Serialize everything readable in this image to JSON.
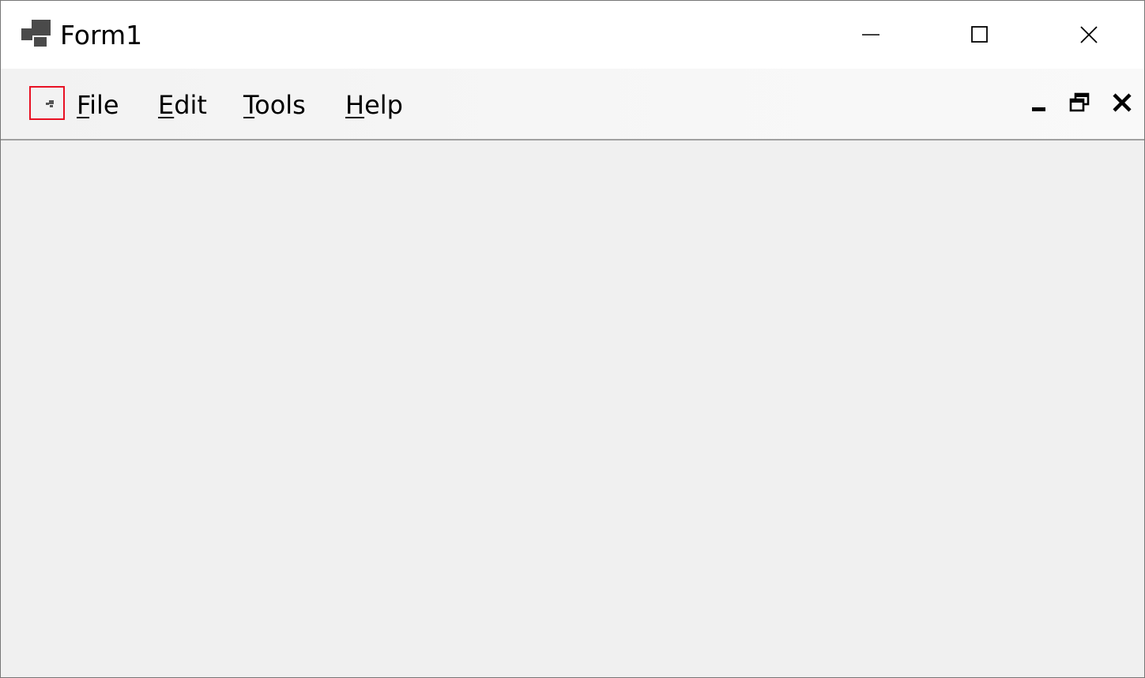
{
  "window": {
    "title": "Form1"
  },
  "caption_buttons": {
    "minimize": "minimize-icon",
    "maximize": "maximize-icon",
    "close": "close-icon"
  },
  "menubar": {
    "items": [
      {
        "mnemonic": "F",
        "rest": "ile"
      },
      {
        "mnemonic": "E",
        "rest": "dit"
      },
      {
        "mnemonic": "T",
        "rest": "ools"
      },
      {
        "mnemonic": "H",
        "rest": "elp"
      }
    ],
    "mdi_controls": {
      "minimize": "mdi-minimize-icon",
      "restore": "mdi-restore-icon",
      "close": "mdi-close-icon"
    }
  },
  "colors": {
    "titlebar": "#ffffff",
    "client": "#f0f0f0",
    "focus_outline": "#e81123"
  }
}
